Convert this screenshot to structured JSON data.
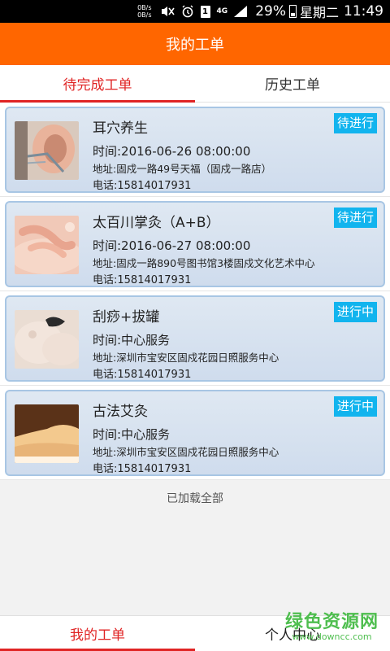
{
  "status_bar": {
    "net_speed_up": "0B/s",
    "net_speed_down": "0B/s",
    "sim": "1",
    "network": "4G",
    "battery": "29%",
    "day": "星期二",
    "time": "11:49"
  },
  "header": {
    "title": "我的工单"
  },
  "tabs": [
    {
      "label": "待完成工单",
      "active": true
    },
    {
      "label": "历史工单",
      "active": false
    }
  ],
  "orders": [
    {
      "title": "耳穴养生",
      "status": "待进行",
      "time": "时间:2016-06-26 08:00:00",
      "address": "地址:固戍一路49号天福（固戍一路店）",
      "phone": "电话:15814017931",
      "image": "ear-acupuncture"
    },
    {
      "title": "太百川掌灸（A+B）",
      "status": "待进行",
      "time": "时间:2016-06-27 08:00:00",
      "address": "地址:固戍一路890号图书馆3楼固戍文化艺术中心",
      "phone": "电话:15814017931",
      "image": "palm-moxibustion"
    },
    {
      "title": "刮痧+拔罐",
      "status": "进行中",
      "time": "时间:中心服务",
      "address": "地址:深圳市宝安区固戍花园日照服务中心",
      "phone": "电话:15814017931",
      "image": "scraping-cupping"
    },
    {
      "title": "古法艾灸",
      "status": "进行中",
      "time": "时间:中心服务",
      "address": "地址:深圳市宝安区固戍花园日照服务中心",
      "phone": "电话:15814017931",
      "image": "ancient-moxibustion"
    }
  ],
  "list_footer": "已加载全部",
  "bottom_nav": [
    {
      "label": "我的工单",
      "active": true
    },
    {
      "label": "个人中心",
      "active": false
    }
  ],
  "watermark": {
    "main": "绿色资源网",
    "sub": "www.downcc.com"
  },
  "colors": {
    "header": "#ff6600",
    "accent": "#e02424",
    "badge": "#12b4ee",
    "card_border": "#a8c6e4"
  }
}
